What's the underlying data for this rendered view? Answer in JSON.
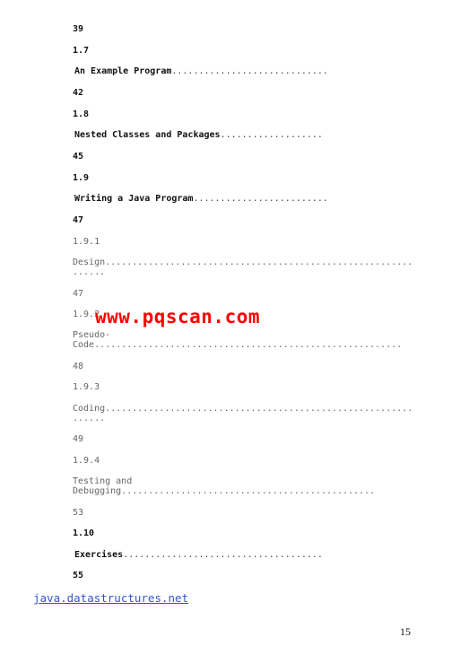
{
  "toc": {
    "p39": "39",
    "s1_7": {
      "num": "1.7",
      "title": "An Example Program",
      "dots": "............................."
    },
    "p42": "42",
    "s1_8": {
      "num": "1.8",
      "title": "Nested Classes and Packages",
      "dots": "..................."
    },
    "p45": "45",
    "s1_9": {
      "num": "1.9",
      "title": "Writing a Java Program",
      "dots": "........................."
    },
    "p47a": "47",
    "s1_9_1": {
      "num": "1.9.1",
      "line1": "Design.........................................................",
      "line2": "......"
    },
    "p47b": "47",
    "s1_9_2": {
      "num": "1.9.2",
      "line1": "Pseudo-",
      "line2": "Code........................................................."
    },
    "p48": "48",
    "s1_9_3": {
      "num": "1.9.3",
      "line1": "Coding.........................................................",
      "line2": "......"
    },
    "p49": "49",
    "s1_9_4": {
      "num": "1.9.4",
      "line1": "Testing and",
      "line2": "Debugging..............................................."
    },
    "p53": "53",
    "s1_10": {
      "num": "1.10",
      "title": "Exercises",
      "dots": "....................................."
    },
    "p55": "55"
  },
  "watermark": "www.pqscan.com",
  "footer_link": "java.datastructures.net",
  "page_number": "15"
}
